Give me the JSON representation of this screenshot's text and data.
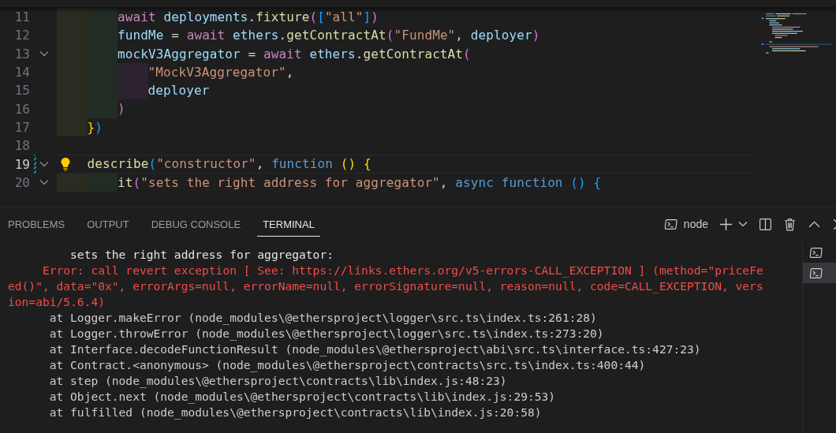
{
  "editor": {
    "lines": [
      {
        "number": "11",
        "fold": false,
        "current": false,
        "lightbulb": false,
        "modified": false,
        "tokens": [
          {
            "kind": "keyword",
            "text": "        await"
          },
          {
            "kind": "variable",
            "text": " deployments"
          },
          {
            "kind": "punctuation",
            "text": "."
          },
          {
            "kind": "function",
            "text": "fixture"
          },
          {
            "kind": "bracket2",
            "text": "("
          },
          {
            "kind": "bracket3",
            "text": "["
          },
          {
            "kind": "string",
            "text": "\"all\""
          },
          {
            "kind": "bracket3",
            "text": "]"
          },
          {
            "kind": "bracket2",
            "text": ")"
          }
        ]
      },
      {
        "number": "12",
        "fold": false,
        "current": false,
        "lightbulb": false,
        "modified": false,
        "tokens": [
          {
            "kind": "variable",
            "text": "        fundMe"
          },
          {
            "kind": "punctuation",
            "text": " = "
          },
          {
            "kind": "keyword",
            "text": "await"
          },
          {
            "kind": "variable",
            "text": " ethers"
          },
          {
            "kind": "punctuation",
            "text": "."
          },
          {
            "kind": "function",
            "text": "getContractAt"
          },
          {
            "kind": "bracket2",
            "text": "("
          },
          {
            "kind": "string",
            "text": "\"FundMe\""
          },
          {
            "kind": "punctuation",
            "text": ", "
          },
          {
            "kind": "variable",
            "text": "deployer"
          },
          {
            "kind": "bracket2",
            "text": ")"
          }
        ]
      },
      {
        "number": "13",
        "fold": true,
        "current": false,
        "lightbulb": false,
        "modified": false,
        "tokens": [
          {
            "kind": "variable",
            "text": "        mockV3Aggregator"
          },
          {
            "kind": "punctuation",
            "text": " = "
          },
          {
            "kind": "keyword",
            "text": "await"
          },
          {
            "kind": "variable",
            "text": " ethers"
          },
          {
            "kind": "punctuation",
            "text": "."
          },
          {
            "kind": "function",
            "text": "getContractAt"
          },
          {
            "kind": "bracket2",
            "text": "("
          }
        ]
      },
      {
        "number": "14",
        "fold": false,
        "current": false,
        "lightbulb": false,
        "modified": false,
        "tokens": [
          {
            "kind": "string",
            "text": "            \"MockV3Aggregator\""
          },
          {
            "kind": "punctuation",
            "text": ","
          }
        ]
      },
      {
        "number": "15",
        "fold": false,
        "current": false,
        "lightbulb": false,
        "modified": false,
        "tokens": [
          {
            "kind": "variable",
            "text": "            deployer"
          }
        ]
      },
      {
        "number": "16",
        "fold": false,
        "current": false,
        "lightbulb": false,
        "modified": false,
        "tokens": [
          {
            "kind": "bracket2",
            "text": "        )"
          }
        ]
      },
      {
        "number": "17",
        "fold": false,
        "current": false,
        "lightbulb": false,
        "modified": false,
        "tokens": [
          {
            "kind": "bracket1",
            "text": "    }"
          },
          {
            "kind": "bracket3",
            "text": ")"
          }
        ]
      },
      {
        "number": "18",
        "fold": false,
        "current": false,
        "lightbulb": false,
        "modified": false
      },
      {
        "number": "19",
        "fold": true,
        "current": true,
        "lightbulb": true,
        "modified": true,
        "tokens": [
          {
            "kind": "function",
            "text": "    describe"
          },
          {
            "kind": "bracket3",
            "text": "("
          },
          {
            "kind": "string",
            "text": "\"constructor\""
          },
          {
            "kind": "punctuation",
            "text": ", "
          },
          {
            "kind": "storage",
            "text": "function"
          },
          {
            "kind": "bracket1",
            "text": " ()"
          },
          {
            "kind": "bracket1",
            "text": " {"
          }
        ]
      },
      {
        "number": "20",
        "fold": true,
        "current": false,
        "lightbulb": false,
        "modified": false,
        "tokens": [
          {
            "kind": "function",
            "text": "        it"
          },
          {
            "kind": "bracket2",
            "text": "("
          },
          {
            "kind": "string",
            "text": "\"sets the right address for aggregator\""
          },
          {
            "kind": "punctuation",
            "text": ", "
          },
          {
            "kind": "storage",
            "text": "async"
          },
          {
            "kind": "storage",
            "text": " function"
          },
          {
            "kind": "bracket3",
            "text": " ()"
          },
          {
            "kind": "bracket3",
            "text": " {"
          }
        ]
      }
    ]
  },
  "panel": {
    "tabs": [
      {
        "label": "PROBLEMS",
        "selected": false
      },
      {
        "label": "OUTPUT",
        "selected": false
      },
      {
        "label": "DEBUG CONSOLE",
        "selected": false
      },
      {
        "label": "TERMINAL",
        "selected": true
      }
    ],
    "terminal_name": "node",
    "output": [
      {
        "kind": "title",
        "text": "         sets the right address for aggregator:"
      },
      {
        "kind": "error",
        "text": "     Error: call revert exception [ See: https://links.ethers.org/v5-errors-CALL_EXCEPTION ] (method=\"priceFeed()\", data=\"0x\", errorArgs=null, errorName=null, errorSignature=null, reason=null, code=CALL_EXCEPTION, version=abi/5.6.4)"
      },
      {
        "kind": "trace",
        "text": "      at Logger.makeError (node_modules\\@ethersproject\\logger\\src.ts\\index.ts:261:28)"
      },
      {
        "kind": "trace",
        "text": "      at Logger.throwError (node_modules\\@ethersproject\\logger\\src.ts\\index.ts:273:20)"
      },
      {
        "kind": "trace",
        "text": "      at Interface.decodeFunctionResult (node_modules\\@ethersproject\\abi\\src.ts\\interface.ts:427:23)"
      },
      {
        "kind": "trace",
        "text": "      at Contract.<anonymous> (node_modules\\@ethersproject\\contracts\\src.ts\\index.ts:400:44)"
      },
      {
        "kind": "trace",
        "text": "      at step (node_modules\\@ethersproject\\contracts\\lib\\index.js:48:23)"
      },
      {
        "kind": "trace",
        "text": "      at Object.next (node_modules\\@ethersproject\\contracts\\lib\\index.js:29:53)"
      },
      {
        "kind": "trace",
        "text": "      at fulfilled (node_modules\\@ethersproject\\contracts\\lib\\index.js:20:58)"
      }
    ],
    "terminals": [
      {
        "selected": false
      },
      {
        "selected": true
      }
    ]
  }
}
